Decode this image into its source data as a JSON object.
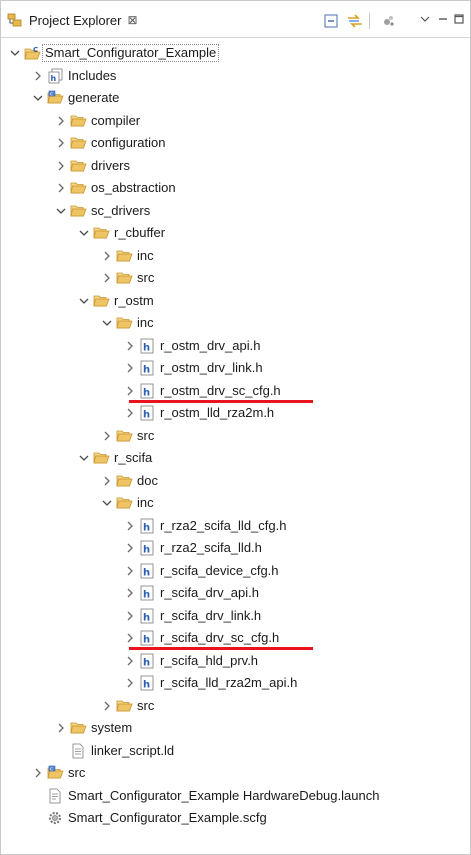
{
  "panel": {
    "tab_title": "Project Explorer",
    "tab_close_glyph": "⊠",
    "toolbar_icons": [
      "collapse-all-icon",
      "link-with-editor-icon",
      "filter-icon",
      "view-menu-icon",
      "minimize-icon",
      "maximize-icon"
    ]
  },
  "tree": [
    {
      "label": "Smart_Configurator_Example",
      "depth": 0,
      "state": "open",
      "icon": "c-project-icon",
      "selected": true
    },
    {
      "label": "Includes",
      "depth": 1,
      "state": "closed",
      "icon": "includes-icon"
    },
    {
      "label": "generate",
      "depth": 1,
      "state": "open",
      "icon": "source-folder-icon"
    },
    {
      "label": "compiler",
      "depth": 2,
      "state": "closed",
      "icon": "folder-icon"
    },
    {
      "label": "configuration",
      "depth": 2,
      "state": "closed",
      "icon": "folder-icon"
    },
    {
      "label": "drivers",
      "depth": 2,
      "state": "closed",
      "icon": "folder-icon"
    },
    {
      "label": "os_abstraction",
      "depth": 2,
      "state": "closed",
      "icon": "folder-icon"
    },
    {
      "label": "sc_drivers",
      "depth": 2,
      "state": "open",
      "icon": "folder-icon"
    },
    {
      "label": "r_cbuffer",
      "depth": 3,
      "state": "open",
      "icon": "folder-icon"
    },
    {
      "label": "inc",
      "depth": 4,
      "state": "closed",
      "icon": "folder-icon"
    },
    {
      "label": "src",
      "depth": 4,
      "state": "closed",
      "icon": "folder-icon"
    },
    {
      "label": "r_ostm",
      "depth": 3,
      "state": "open",
      "icon": "folder-icon"
    },
    {
      "label": "inc",
      "depth": 4,
      "state": "open",
      "icon": "folder-icon"
    },
    {
      "label": "r_ostm_drv_api.h",
      "depth": 5,
      "state": "closed",
      "icon": "header-file-icon"
    },
    {
      "label": "r_ostm_drv_link.h",
      "depth": 5,
      "state": "closed",
      "icon": "header-file-icon"
    },
    {
      "label": "r_ostm_drv_sc_cfg.h",
      "depth": 5,
      "state": "closed",
      "icon": "header-file-icon",
      "underline": true
    },
    {
      "label": "r_ostm_lld_rza2m.h",
      "depth": 5,
      "state": "closed",
      "icon": "header-file-icon"
    },
    {
      "label": "src",
      "depth": 4,
      "state": "closed",
      "icon": "folder-icon"
    },
    {
      "label": "r_scifa",
      "depth": 3,
      "state": "open",
      "icon": "folder-icon"
    },
    {
      "label": "doc",
      "depth": 4,
      "state": "closed",
      "icon": "folder-icon"
    },
    {
      "label": "inc",
      "depth": 4,
      "state": "open",
      "icon": "folder-icon"
    },
    {
      "label": "r_rza2_scifa_lld_cfg.h",
      "depth": 5,
      "state": "closed",
      "icon": "header-file-icon"
    },
    {
      "label": "r_rza2_scifa_lld.h",
      "depth": 5,
      "state": "closed",
      "icon": "header-file-icon"
    },
    {
      "label": "r_scifa_device_cfg.h",
      "depth": 5,
      "state": "closed",
      "icon": "header-file-icon"
    },
    {
      "label": "r_scifa_drv_api.h",
      "depth": 5,
      "state": "closed",
      "icon": "header-file-icon"
    },
    {
      "label": "r_scifa_drv_link.h",
      "depth": 5,
      "state": "closed",
      "icon": "header-file-icon"
    },
    {
      "label": "r_scifa_drv_sc_cfg.h",
      "depth": 5,
      "state": "closed",
      "icon": "header-file-icon",
      "underline": true
    },
    {
      "label": "r_scifa_hld_prv.h",
      "depth": 5,
      "state": "closed",
      "icon": "header-file-icon"
    },
    {
      "label": "r_scifa_lld_rza2m_api.h",
      "depth": 5,
      "state": "closed",
      "icon": "header-file-icon"
    },
    {
      "label": "src",
      "depth": 4,
      "state": "closed",
      "icon": "folder-icon"
    },
    {
      "label": "system",
      "depth": 2,
      "state": "closed",
      "icon": "folder-icon"
    },
    {
      "label": "linker_script.ld",
      "depth": 2,
      "state": "none",
      "icon": "text-file-icon"
    },
    {
      "label": "src",
      "depth": 1,
      "state": "closed",
      "icon": "source-folder-icon"
    },
    {
      "label": "Smart_Configurator_Example HardwareDebug.launch",
      "depth": 1,
      "state": "none",
      "icon": "launch-file-icon"
    },
    {
      "label": "Smart_Configurator_Example.scfg",
      "depth": 1,
      "state": "none",
      "icon": "gear-file-icon"
    }
  ],
  "colors": {
    "folder": "#e8b84a",
    "folder_dark": "#c9952c",
    "header_file": "#2b5fb4",
    "highlight_underline": "#e8131f"
  }
}
